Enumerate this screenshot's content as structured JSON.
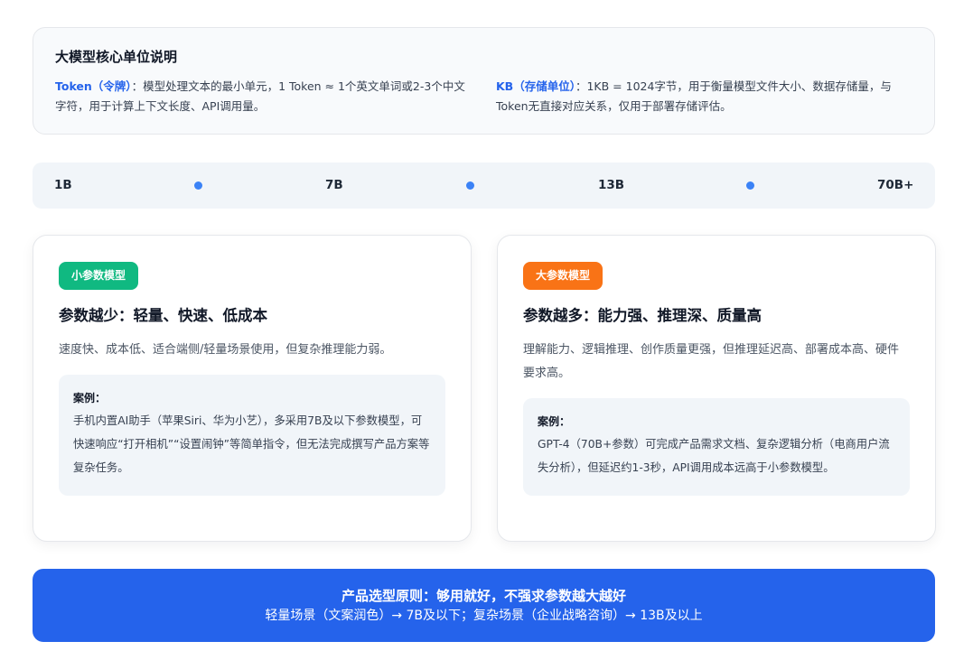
{
  "intro": {
    "title": "大模型核心单位说明",
    "token": {
      "term": "Token（令牌）",
      "text": "：模型处理文本的最小单元，1 Token ≈ 1个英文单词或2-3个中文字符，用于计算上下文长度、API调用量。"
    },
    "kb": {
      "term": "KB（存储单位）",
      "text": "：1KB = 1024字节，用于衡量模型文件大小、数据存储量，与Token无直接对应关系，仅用于部署存储评估。"
    }
  },
  "scale": {
    "labels": [
      "1B",
      "7B",
      "13B",
      "70B+"
    ],
    "dot_color": "#3b82f6"
  },
  "small_model": {
    "badge": "小参数模型",
    "badge_color": "#10b981",
    "heading": "参数越少：轻量、快速、低成本",
    "description": "速度快、成本低、适合端侧/轻量场景使用，但复杂推理能力弱。",
    "case_label": "案例：",
    "case_text": "手机内置AI助手（苹果Siri、华为小艺），多采用7B及以下参数模型，可快速响应“打开相机”“设置闹钟”等简单指令，但无法完成撰写产品方案等复杂任务。"
  },
  "large_model": {
    "badge": "大参数模型",
    "badge_color": "#f97316",
    "heading": "参数越多：能力强、推理深、质量高",
    "description": "理解能力、逻辑推理、创作质量更强，但推理延迟高、部署成本高、硬件要求高。",
    "case_label": "案例：",
    "case_text": "GPT-4（70B+参数）可完成产品需求文档、复杂逻辑分析（电商用户流失分析），但延迟约1-3秒，API调用成本远高于小参数模型。"
  },
  "principle": {
    "title": "产品选型原则：够用就好，不强求参数越大越好",
    "subtitle": "轻量场景（文案润色）→ 7B及以下；复杂场景（企业战略咨询）→ 13B及以上",
    "color": "#2563eb"
  }
}
